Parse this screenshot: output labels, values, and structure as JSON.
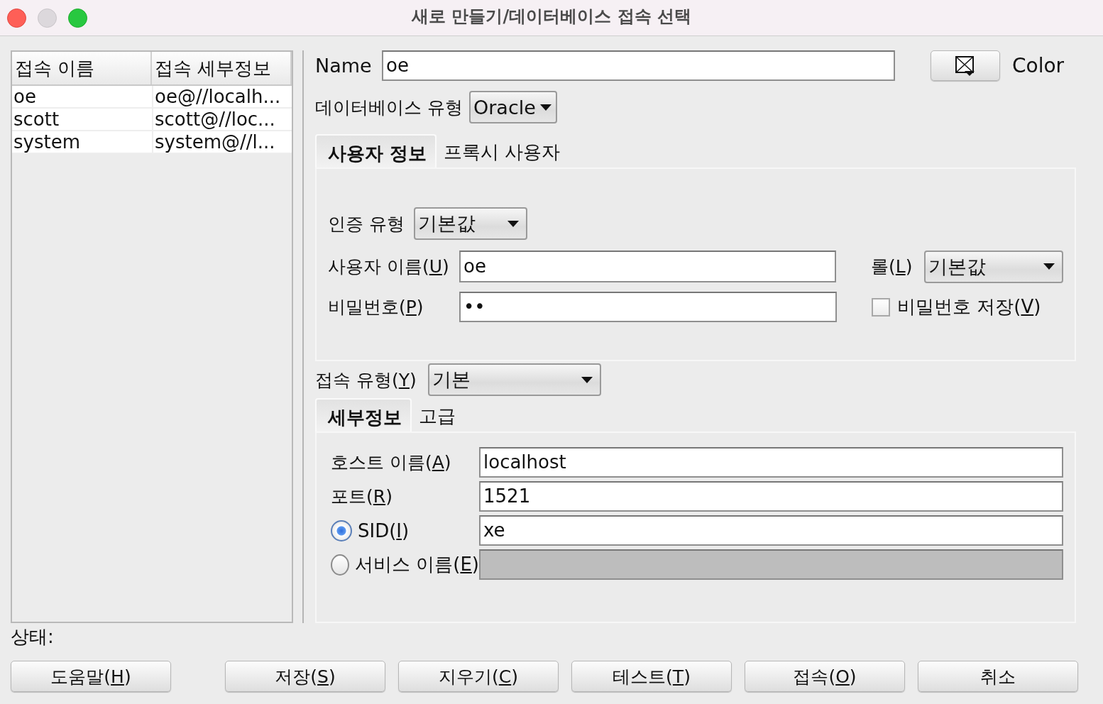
{
  "window": {
    "title": "새로 만들기/데이터베이스 접속 선택"
  },
  "connections": {
    "columns": [
      "접속 이름",
      "접속 세부정보"
    ],
    "rows": [
      {
        "name": "oe",
        "details": "oe@//localh..."
      },
      {
        "name": "scott",
        "details": "scott@//loc..."
      },
      {
        "name": "system",
        "details": "system@//l..."
      }
    ]
  },
  "name_field": {
    "label": "Name",
    "value": "oe"
  },
  "color": {
    "label": "Color"
  },
  "database_type": {
    "label": "데이터베이스 유형",
    "value": "Oracle"
  },
  "user_tabs": [
    {
      "label": "사용자 정보",
      "selected": true
    },
    {
      "label": "프록시 사용자",
      "selected": false
    }
  ],
  "auth_type": {
    "label": "인증 유형",
    "value": "기본값"
  },
  "username": {
    "label": "사용자 이름(U)",
    "value": "oe"
  },
  "role": {
    "label": "롤(L)",
    "value": "기본값"
  },
  "password": {
    "label": "비밀번호(P)",
    "value": "••"
  },
  "save_password": {
    "label": "비밀번호 저장(V)",
    "checked": false
  },
  "connection_type": {
    "label": "접속 유형(Y)",
    "value": "기본"
  },
  "detail_tabs": [
    {
      "label": "세부정보",
      "selected": true
    },
    {
      "label": "고급",
      "selected": false
    }
  ],
  "hostname": {
    "label": "호스트 이름(A)",
    "value": "localhost"
  },
  "port": {
    "label": "포트(R)",
    "value": "1521"
  },
  "sid_options": [
    {
      "label": "SID(I)",
      "selected": true,
      "value": "xe"
    },
    {
      "label": "서비스 이름(E)",
      "selected": false
    }
  ],
  "status": {
    "label": "상태:"
  },
  "buttons": [
    {
      "label": "도움말(H)"
    },
    {
      "label": "저장(S)"
    },
    {
      "label": "지우기(C)"
    },
    {
      "label": "테스트(T)"
    },
    {
      "label": "접속(O)"
    },
    {
      "label": "취소"
    }
  ]
}
